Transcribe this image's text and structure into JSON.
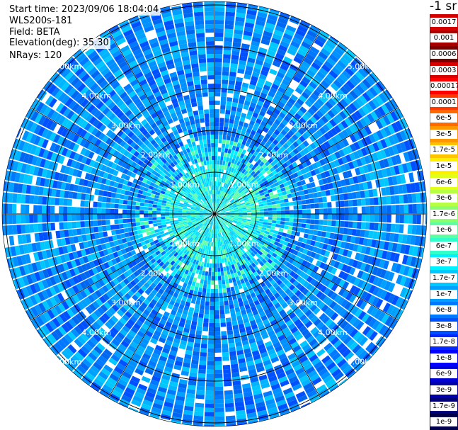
{
  "info": {
    "start_time": "Start time: 2023/09/06 18:04:04",
    "instrument": "WLS200s-181",
    "field": "Field: BETA",
    "elevation": "Elevation(deg): 35.30",
    "nrays": "NRays: 120"
  },
  "colorbar": {
    "title": "-1 sr",
    "colors": [
      "#d40000",
      "#a50000",
      "#7a0000",
      "#d40000",
      "#ff0000",
      "#ff3a00",
      "#ff6a00",
      "#ff9800",
      "#ffc400",
      "#fff000",
      "#e2ff1a",
      "#b6ff44",
      "#8aff70",
      "#5effa0",
      "#30ffcc",
      "#00f0ff",
      "#00c8ff",
      "#00a0ff",
      "#0078ff",
      "#0050ff",
      "#0028ff",
      "#0000ff",
      "#0000d2",
      "#0000a6",
      "#000078",
      "#00004a"
    ],
    "labels": [
      "0.0017",
      "0.001",
      "0.0006",
      "0.0003",
      "0.00017",
      "0.0001",
      "6e-5",
      "3e-5",
      "1.7e-5",
      "1e-5",
      "6e-6",
      "3e-6",
      "1.7e-6",
      "1e-6",
      "6e-7",
      "3e-7",
      "1.7e-7",
      "1e-7",
      "6e-8",
      "3e-8",
      "1.7e-8",
      "1e-8",
      "6e-9",
      "3e-9",
      "1.7e-9",
      "1e-9"
    ]
  },
  "plot": {
    "ring_labels": [
      "1.00km",
      "2.00km",
      "3.00km",
      "4.00km",
      "5.00km"
    ],
    "n_rays": 120
  }
}
